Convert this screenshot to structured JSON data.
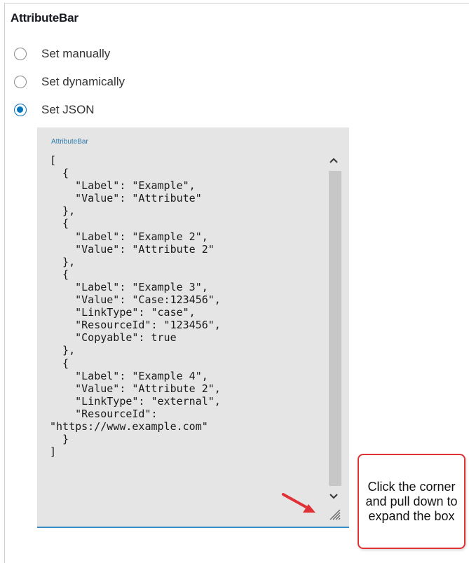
{
  "section": {
    "title": "AttributeBar"
  },
  "radio_options": [
    {
      "label": "Set manually",
      "checked": false
    },
    {
      "label": "Set dynamically",
      "checked": false
    },
    {
      "label": "Set JSON",
      "checked": true
    }
  ],
  "json_editor": {
    "label": "AttributeBar",
    "value": "[\n  {\n    \"Label\": \"Example\",\n    \"Value\": \"Attribute\"\n  },\n  {\n    \"Label\": \"Example 2\",\n    \"Value\": \"Attribute 2\"\n  },\n  {\n    \"Label\": \"Example 3\",\n    \"Value\": \"Case:123456\",\n    \"LinkType\": \"case\",\n    \"ResourceId\": \"123456\",\n    \"Copyable\": true\n  },\n  {\n    \"Label\": \"Example 4\",\n    \"Value\": \"Attribute 2\",\n    \"LinkType\": \"external\",\n    \"ResourceId\":\n\"https://www.example.com\"\n  }\n]",
    "icons": {
      "scroll_up": "chevron-up-icon",
      "scroll_down": "chevron-down-icon",
      "resize": "resize-grip-icon"
    }
  },
  "callout": {
    "text": "Click the corner and pull down to expand the box",
    "border_color": "#e03236"
  },
  "colors": {
    "accent": "#0073bb",
    "editor_background": "#e5e5e5",
    "editor_underline": "#3a8dc2",
    "arrow": "#e03236"
  }
}
